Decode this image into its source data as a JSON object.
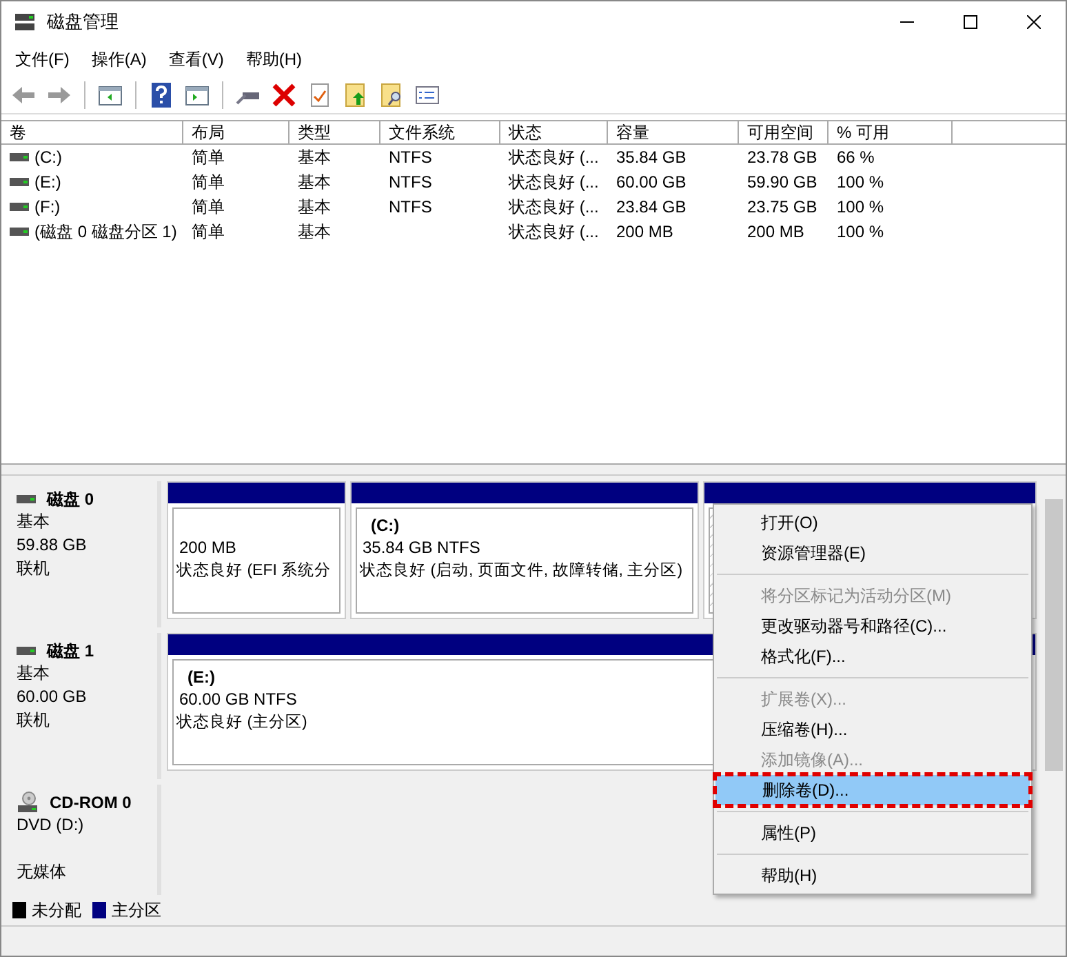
{
  "window": {
    "title": "磁盘管理"
  },
  "menu_bar": [
    "文件(F)",
    "操作(A)",
    "查看(V)",
    "帮助(H)"
  ],
  "table": {
    "columns": [
      "卷",
      "布局",
      "类型",
      "文件系统",
      "状态",
      "容量",
      "可用空间",
      "% 可用"
    ],
    "rows": [
      [
        "(C:)",
        "简单",
        "基本",
        "NTFS",
        "状态良好 (...",
        "35.84 GB",
        "23.78 GB",
        "66 %"
      ],
      [
        "(E:)",
        "简单",
        "基本",
        "NTFS",
        "状态良好 (...",
        "60.00 GB",
        "59.90 GB",
        "100 %"
      ],
      [
        "(F:)",
        "简单",
        "基本",
        "NTFS",
        "状态良好 (...",
        "23.84 GB",
        "23.75 GB",
        "100 %"
      ],
      [
        "(磁盘 0 磁盘分区 1)",
        "简单",
        "基本",
        "",
        "状态良好 (...",
        "200 MB",
        "200 MB",
        "100 %"
      ]
    ]
  },
  "disks": [
    {
      "kind": "disk",
      "name": "磁盘 0",
      "lines": [
        "基本",
        "59.88 GB",
        "联机"
      ],
      "partitions": [
        {
          "kind": "primary",
          "size": "200 MB",
          "status": "状态良好 (EFI 系统分"
        },
        {
          "kind": "primary",
          "label": "(C:)",
          "size": "35.84 GB NTFS",
          "status": "状态良好 (启动, 页面文件, 故障转储, 主分区)"
        },
        {
          "kind": "hatched"
        }
      ]
    },
    {
      "kind": "disk",
      "name": "磁盘 1",
      "lines": [
        "基本",
        "60.00 GB",
        "联机"
      ],
      "partitions": [
        {
          "kind": "primary",
          "label": "(E:)",
          "size": "60.00 GB NTFS",
          "status": "状态良好 (主分区)"
        }
      ]
    },
    {
      "kind": "cdrom",
      "name": "CD-ROM 0",
      "lines": [
        "DVD (D:)",
        "无媒体"
      ]
    }
  ],
  "legend": [
    {
      "label": "未分配",
      "color": "#000000"
    },
    {
      "label": "主分区",
      "color": "#000080"
    }
  ],
  "context_menu": [
    {
      "kind": "item",
      "label": "打开(O)",
      "disabled": false,
      "selected": false
    },
    {
      "kind": "item",
      "label": "资源管理器(E)",
      "disabled": false,
      "selected": false
    },
    {
      "kind": "separator"
    },
    {
      "kind": "item",
      "label": "将分区标记为活动分区(M)",
      "disabled": true,
      "selected": false
    },
    {
      "kind": "item",
      "label": "更改驱动器号和路径(C)...",
      "disabled": false,
      "selected": false
    },
    {
      "kind": "item",
      "label": "格式化(F)...",
      "disabled": false,
      "selected": false
    },
    {
      "kind": "separator"
    },
    {
      "kind": "item",
      "label": "扩展卷(X)...",
      "disabled": true,
      "selected": false
    },
    {
      "kind": "item",
      "label": "压缩卷(H)...",
      "disabled": false,
      "selected": false
    },
    {
      "kind": "item",
      "label": "添加镜像(A)...",
      "disabled": true,
      "selected": false
    },
    {
      "kind": "item",
      "label": "删除卷(D)...",
      "disabled": false,
      "selected": true
    },
    {
      "kind": "separator"
    },
    {
      "kind": "item",
      "label": "属性(P)",
      "disabled": false,
      "selected": false
    },
    {
      "kind": "separator"
    },
    {
      "kind": "item",
      "label": "帮助(H)",
      "disabled": false,
      "selected": false
    }
  ]
}
